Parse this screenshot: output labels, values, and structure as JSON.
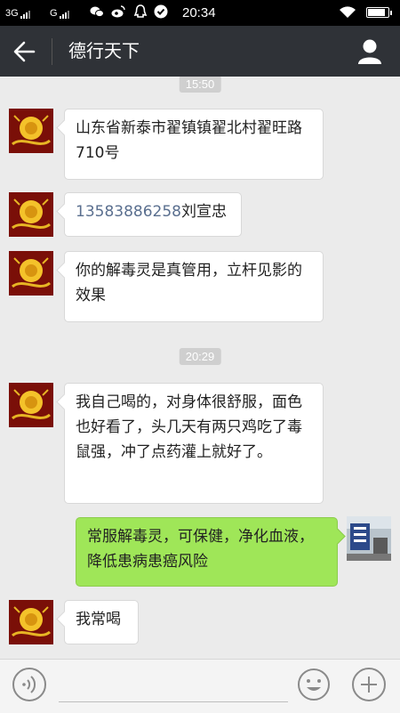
{
  "status": {
    "sim1": "3G",
    "sim2": "G",
    "time": "20:34",
    "battery_level": 0.9,
    "icons": [
      "wechat-icon",
      "weibo-icon",
      "qq-icon",
      "check-circle-icon",
      "wifi-icon",
      "battery-charging-icon"
    ]
  },
  "header": {
    "title": "德行天下",
    "back_icon": "arrow-left-icon",
    "profile_icon": "person-icon",
    "background": "#2f3237"
  },
  "chat": {
    "timestamps": [
      "15:50",
      "20:29"
    ],
    "messages": [
      {
        "side": "left",
        "text": "山东省新泰市翟镇镇翟北村翟旺路710号"
      },
      {
        "side": "left",
        "link": "13583886258",
        "text": "刘宣忠"
      },
      {
        "side": "left",
        "text": "你的解毒灵是真管用，立杆见影的效果"
      },
      {
        "side": "left",
        "text": "我自己喝的，对身体很舒服，面色也好看了，头几天有两只鸡吃了毒鼠强，冲了点药灌上就好了。"
      },
      {
        "side": "right",
        "text": "常服解毒灵，可保健，净化血液，降低患病患癌风险"
      },
      {
        "side": "left",
        "text": "我常喝"
      }
    ],
    "colors": {
      "incoming": "#ffffff",
      "outgoing": "#9fe658",
      "background": "#ebebeb"
    }
  },
  "input": {
    "voice_icon": "voice-icon",
    "emoji_icon": "emoji-icon",
    "plus_icon": "plus-icon"
  }
}
